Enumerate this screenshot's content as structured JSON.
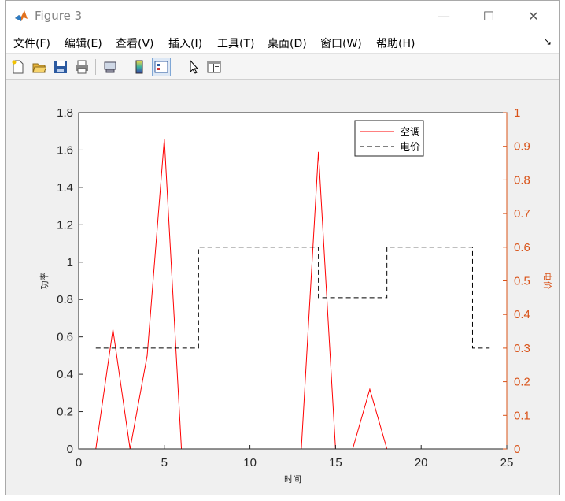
{
  "window": {
    "title": "Figure 3",
    "controls": {
      "minimize": "—",
      "maximize": "☐",
      "close": "✕"
    }
  },
  "menu": {
    "items": [
      {
        "label": "文件(F)"
      },
      {
        "label": "编辑(E)"
      },
      {
        "label": "查看(V)"
      },
      {
        "label": "插入(I)"
      },
      {
        "label": "工具(T)"
      },
      {
        "label": "桌面(D)"
      },
      {
        "label": "窗口(W)"
      },
      {
        "label": "帮助(H)"
      }
    ],
    "dock_arrow": "↘"
  },
  "toolbar": {
    "icons": [
      "new-figure-icon",
      "open-file-icon",
      "save-icon",
      "print-icon",
      "link-icon",
      "insert-colorbar-icon",
      "insert-legend-icon",
      "pointer-icon",
      "property-inspector-icon"
    ]
  },
  "colors": {
    "left_axis": "#262626",
    "right_axis": "#d95319",
    "series_ac": "#ff0000",
    "series_price": "#000000"
  },
  "chart_data": {
    "type": "line",
    "xlabel": "时间",
    "ylabel": "功率",
    "ylabel_right": "电价",
    "xlim": [
      0,
      25
    ],
    "ylim": [
      0,
      1.8
    ],
    "ylim_right": [
      0,
      1
    ],
    "xticks": [
      0,
      5,
      10,
      15,
      20,
      25
    ],
    "yticks": [
      0,
      0.2,
      0.4,
      0.6,
      0.8,
      1,
      1.2,
      1.4,
      1.6,
      1.8
    ],
    "yticks_right": [
      0,
      0.1,
      0.2,
      0.3,
      0.4,
      0.5,
      0.6,
      0.7,
      0.8,
      0.9,
      1
    ],
    "grid": false,
    "legend_position": "top-right",
    "series": [
      {
        "name": "空调",
        "axis": "left",
        "style": "solid",
        "color": "#ff0000",
        "x": [
          1,
          2,
          3,
          4,
          5,
          6,
          7,
          8,
          9,
          10,
          11,
          12,
          13,
          14,
          15,
          16,
          17,
          18,
          19,
          20,
          21,
          22,
          23,
          24
        ],
        "y": [
          0,
          0.64,
          0,
          0.5,
          1.66,
          0,
          0,
          0,
          0,
          0,
          0,
          0,
          0,
          1.59,
          0,
          0,
          0.32,
          0,
          0,
          0,
          0,
          0,
          0,
          0
        ]
      },
      {
        "name": "电价",
        "axis": "right",
        "style": "dashed-step",
        "color": "#000000",
        "x": [
          1,
          7,
          7,
          14,
          14,
          18,
          18,
          23,
          23,
          24
        ],
        "y": [
          0.3,
          0.3,
          0.6,
          0.6,
          0.45,
          0.45,
          0.6,
          0.6,
          0.3,
          0.3
        ]
      }
    ]
  }
}
